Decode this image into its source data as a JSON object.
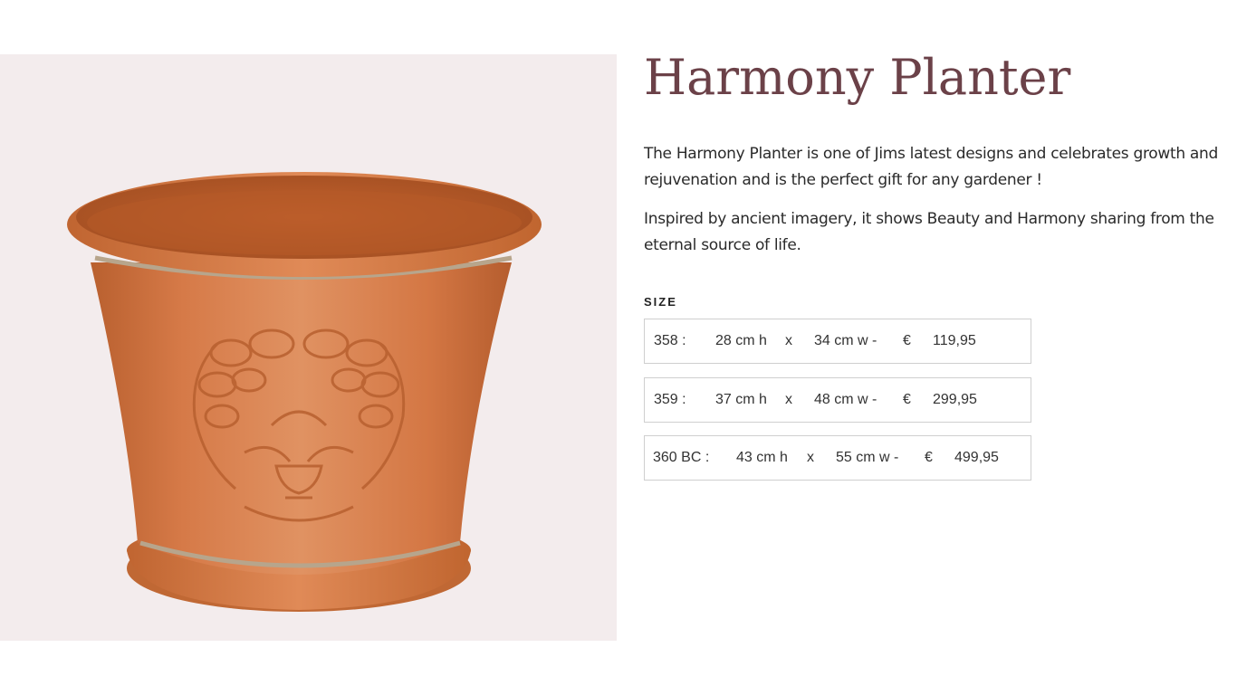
{
  "product": {
    "title": "Harmony Planter",
    "description_1": "The Harmony Planter is one of Jims latest designs and celebrates growth and rejuvenation and is the perfect gift for any gardener !",
    "description_2": "Inspired by ancient imagery, it shows Beauty and Harmony sharing from the eternal source of life.",
    "image_icon": "terracotta-planter-photo"
  },
  "size": {
    "label": "SIZE",
    "options": [
      {
        "code": "358 :",
        "height": "28 cm  h",
        "x": "x",
        "width": "34 cm  w  -",
        "currency": "€",
        "price": "119,95"
      },
      {
        "code": "359 :",
        "height": "37 cm  h",
        "x": "x",
        "width": "48 cm  w  -",
        "currency": "€",
        "price": "299,95"
      },
      {
        "code": "360 BC :",
        "height": "43 cm  h",
        "x": "x",
        "width": "55 cm  w  -",
        "currency": "€",
        "price": "499,95"
      }
    ]
  },
  "colors": {
    "title": "#6b4148",
    "image_background": "#f3eced",
    "terracotta": "#d7794a",
    "border": "#cfcfcf"
  }
}
